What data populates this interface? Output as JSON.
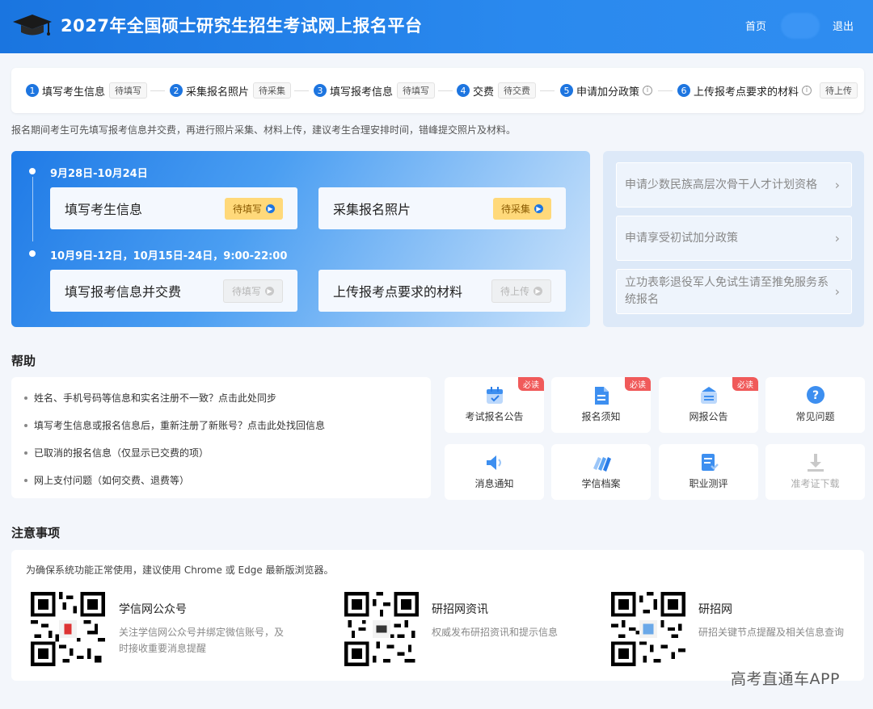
{
  "header": {
    "title": "2027年全国硕士研究生招生考试网上报名平台",
    "nav_home": "首页",
    "nav_logout": "退出"
  },
  "steps": [
    {
      "num": "1",
      "label": "填写考生信息",
      "tag": "待填写",
      "info": false
    },
    {
      "num": "2",
      "label": "采集报名照片",
      "tag": "待采集",
      "info": false
    },
    {
      "num": "3",
      "label": "填写报考信息",
      "tag": "待填写",
      "info": false
    },
    {
      "num": "4",
      "label": "交费",
      "tag": "待交费",
      "info": false
    },
    {
      "num": "5",
      "label": "申请加分政策",
      "tag": "",
      "info": true
    },
    {
      "num": "6",
      "label": "上传报考点要求的材料",
      "tag": "待上传",
      "info": true
    }
  ],
  "notice": "报名期间考生可先填写报考信息并交费，再进行照片采集、材料上传，建议考生合理安排时间，错峰提交照片及材料。",
  "timeline": {
    "period1": "9月28日-10月24日",
    "period2": "10月9日-12日，10月15日-24日，9:00-22:00",
    "cards": [
      {
        "title": "填写考生信息",
        "button": "待填写",
        "state": "active"
      },
      {
        "title": "采集报名照片",
        "button": "待采集",
        "state": "active"
      },
      {
        "title": "填写报考信息并交费",
        "button": "待填写",
        "state": "disabled"
      },
      {
        "title": "上传报考点要求的材料",
        "button": "待上传",
        "state": "disabled"
      }
    ]
  },
  "policy": {
    "items": [
      "申请少数民族高层次骨干人才计划资格",
      "申请享受初试加分政策",
      "立功表彰退役军人免试生请至推免服务系统报名"
    ]
  },
  "help": {
    "title": "帮助",
    "items": [
      "姓名、手机号码等信息和实名注册不一致？点击此处同步",
      "填写考生信息或报名信息后，重新注册了新账号？点击此处找回信息",
      "已取消的报名信息（仅显示已交费的项）",
      "网上支付问题（如何交费、退费等）"
    ]
  },
  "tiles": [
    {
      "label": "考试报名公告",
      "badge": "必读",
      "icon": "calendar-icon"
    },
    {
      "label": "报名须知",
      "badge": "必读",
      "icon": "document-icon"
    },
    {
      "label": "网报公告",
      "badge": "必读",
      "icon": "briefcase-icon"
    },
    {
      "label": "常见问题",
      "badge": "",
      "icon": "question-icon"
    },
    {
      "label": "消息通知",
      "badge": "",
      "icon": "speaker-icon"
    },
    {
      "label": "学信档案",
      "badge": "",
      "icon": "archive-icon"
    },
    {
      "label": "职业测评",
      "badge": "",
      "icon": "assessment-icon"
    },
    {
      "label": "准考证下载",
      "badge": "",
      "icon": "download-icon"
    }
  ],
  "notes": {
    "title": "注意事项",
    "tip": "为确保系统功能正常使用，建议使用 Chrome 或 Edge 最新版浏览器。",
    "qrs": [
      {
        "title": "学信网公众号",
        "desc1": "关注学信网公众号并绑定微信账号，及",
        "desc2": "时接收重要消息提醒"
      },
      {
        "title": "研招网资讯",
        "desc1": "权威发布研招资讯和提示信息",
        "desc2": ""
      },
      {
        "title": "研招网",
        "desc1": "研招关键节点提醒及相关信息查询",
        "desc2": ""
      }
    ]
  },
  "watermark": "高考直通车APP",
  "colors": {
    "primary": "#1d75e0",
    "badge": "#f05a5a",
    "pending": "#ffd97a"
  }
}
